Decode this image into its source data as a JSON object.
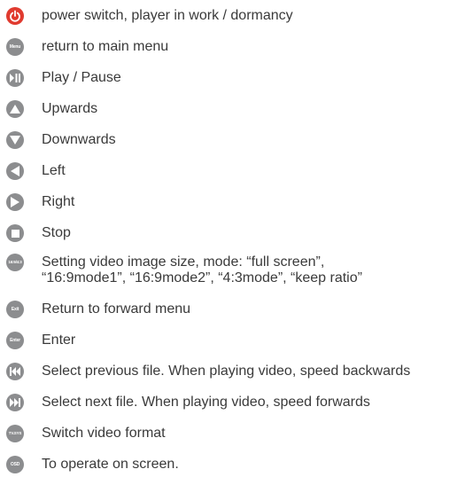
{
  "rows": [
    {
      "icon": "power-icon",
      "text": "power switch, player in work / dormancy"
    },
    {
      "icon": "menu-icon",
      "icon_text": "Menu",
      "text": "return to main menu"
    },
    {
      "icon": "play-pause-icon",
      "text": "Play / Pause"
    },
    {
      "icon": "up-icon",
      "text": "Upwards"
    },
    {
      "icon": "down-icon",
      "text": "Downwards"
    },
    {
      "icon": "left-icon",
      "text": "Left"
    },
    {
      "icon": "right-icon",
      "text": "Right"
    },
    {
      "icon": "stop-icon",
      "text": "Stop"
    },
    {
      "icon": "aspect-ratio-icon",
      "icon_text": "16:9/4:3",
      "text": "Setting video image size, mode: “full screen”,",
      "text2": "“16:9mode1”, “16:9mode2”, “4:3mode”, “keep ratio”"
    },
    {
      "icon": "exit-icon",
      "icon_text": "Exit",
      "text": "Return to forward menu"
    },
    {
      "icon": "enter-icon",
      "icon_text": "Enter",
      "text": "Enter"
    },
    {
      "icon": "previous-icon",
      "text": "Select previous file. When playing video, speed backwards"
    },
    {
      "icon": "next-icon",
      "text": "Select next file. When playing video, speed forwards"
    },
    {
      "icon": "tv-sys-icon",
      "icon_text": "TV.SYS",
      "text": "Switch video format"
    },
    {
      "icon": "osd-icon",
      "icon_text": "OSD",
      "text": "To operate on screen."
    }
  ],
  "colors": {
    "icon_gray": "#8c8d8f",
    "power_red": "#e03a2f",
    "text": "#3a3a3a"
  }
}
